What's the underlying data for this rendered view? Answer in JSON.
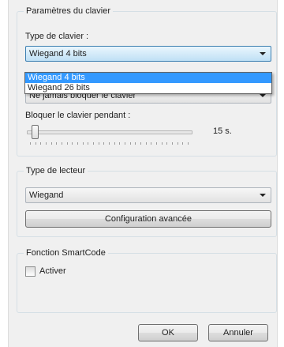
{
  "keyboard_settings": {
    "group_title": "Paramètres du clavier",
    "keyboard_type_label": "Type de clavier :",
    "keyboard_type_value": "Wiegand 4 bits",
    "keyboard_type_options": [
      "Wiegand 4 bits",
      "Wiegand 26 bits"
    ],
    "lock_combo_value": "Ne jamais bloquer le clavier",
    "lock_duration_label": "Bloquer le clavier pendant :",
    "lock_duration_value": "15 s.",
    "lock_duration_slider_fraction": 0.05
  },
  "reader_type": {
    "group_title": "Type de lecteur",
    "value": "Wiegand",
    "advanced_button": "Configuration avancée"
  },
  "smartcode": {
    "group_title": "Fonction SmartCode",
    "activate_label": "Activer",
    "activate_checked": false
  },
  "footer": {
    "ok_button": "OK",
    "cancel_button": "Annuler"
  },
  "colors": {
    "selection": "#3399ff",
    "window_bg": "#f0f0f0",
    "group_border": "#d5dfe5"
  }
}
